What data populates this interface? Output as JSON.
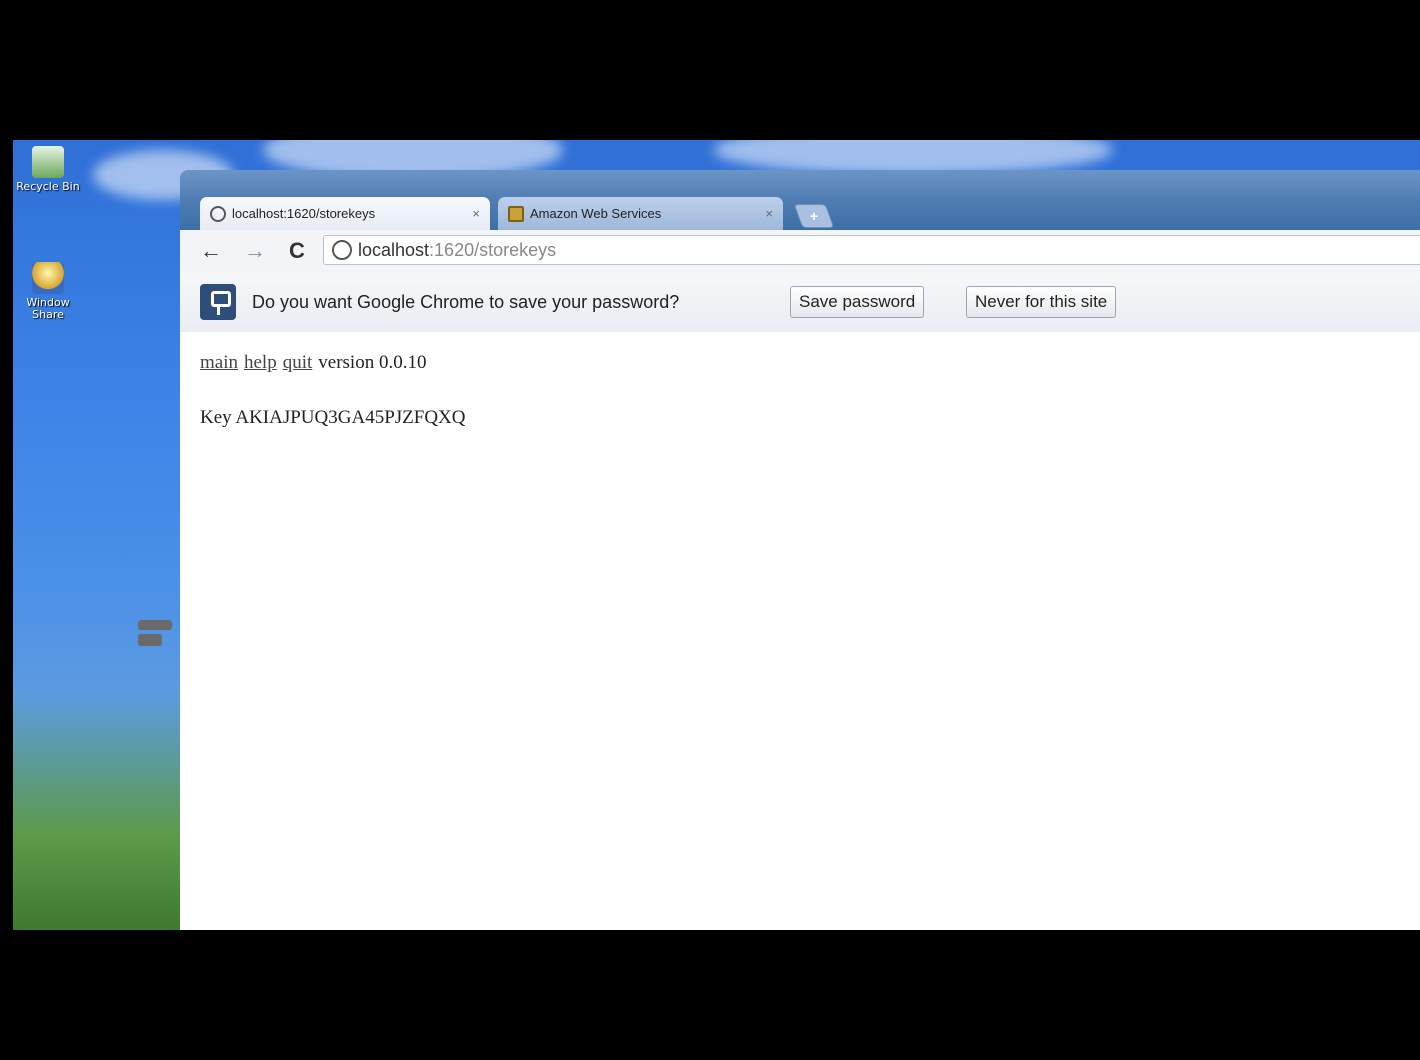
{
  "desktop": {
    "icons": [
      {
        "name": "recycle-bin-icon",
        "label": "Recycle Bin"
      },
      {
        "name": "user-folder-icon",
        "label": "Window Share"
      }
    ]
  },
  "browser": {
    "tabs": [
      {
        "title": "localhost:1620/storekeys",
        "close": "×",
        "active": true
      },
      {
        "title": "Amazon Web Services",
        "close": "×",
        "active": false
      }
    ],
    "new_tab_symbol": "+",
    "toolbar": {
      "back": "←",
      "forward": "→",
      "reload": "C",
      "url_host": "localhost",
      "url_path": ":1620/storekeys"
    },
    "infobar": {
      "message": "Do you want Google Chrome to save your password?",
      "save_button": "Save password",
      "never_button": "Never for this site"
    },
    "page": {
      "links": [
        "main",
        "help",
        "quit"
      ],
      "version_text": "version 0.0.10",
      "key_label": "Key",
      "key_value": "AKIAJPUQ3GA45PJZFQXQ"
    }
  }
}
